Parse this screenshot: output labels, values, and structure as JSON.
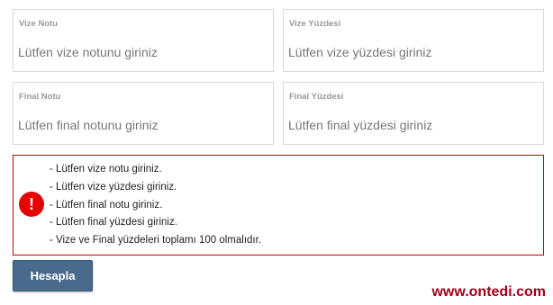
{
  "fields": {
    "vize_notu": {
      "label": "Vize Notu",
      "value": "",
      "placeholder": "Lütfen vize notunu giriniz"
    },
    "vize_yuzdesi": {
      "label": "Vize Yüzdesi",
      "value": "",
      "placeholder": "Lütfen vize yüzdesi giriniz"
    },
    "final_notu": {
      "label": "Final Notu",
      "value": "",
      "placeholder": "Lütfen final notunu giriniz"
    },
    "final_yuzdesi": {
      "label": "Final Yüzdesi",
      "value": "",
      "placeholder": "Lütfen final yüzdesi giriniz"
    }
  },
  "errors": {
    "icon": "exclamation-icon",
    "icon_glyph": "!",
    "color": "#cc0000",
    "messages": [
      "- Lütfen vize notu giriniz.",
      "- Lütfen vize yüzdesi giriniz.",
      "- Lütfen final notu giriniz.",
      "- Lütfen final yüzdesi giriniz.",
      "- Vize ve Final yüzdeleri toplamı 100 olmalıdır."
    ]
  },
  "actions": {
    "calculate_label": "Hesapla",
    "button_color": "#4a6a8c"
  },
  "watermark": {
    "text": "www.ontedi.com",
    "color": "#a3001c"
  }
}
